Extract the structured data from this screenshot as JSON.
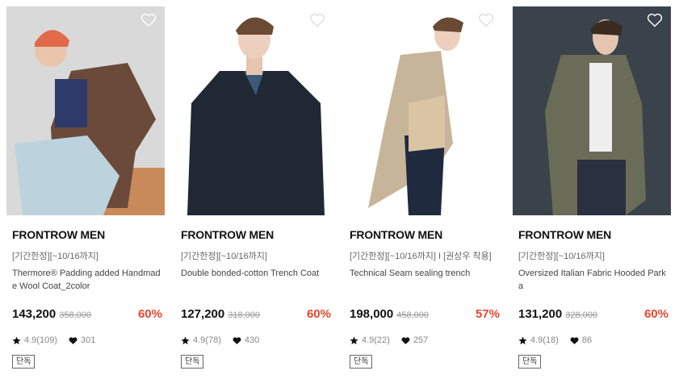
{
  "products": [
    {
      "brand": "FRONTROW MEN",
      "promo": "[기간한정][~10/16까지]",
      "name": "Thermore® Padding added Handmade Wool Coat_2color",
      "price": "143,200",
      "original_price": "358,000",
      "discount": "60%",
      "rating": "4.9(109)",
      "likes": "301",
      "tag": "단독",
      "colors": {
        "bg": "#d9d9d9",
        "coat": "#6b4a3a",
        "trouser": "#bcd3de",
        "accent": "#e06a4a"
      }
    },
    {
      "brand": "FRONTROW MEN",
      "promo": "[기간한정][~10/16까지]",
      "name": "Double bonded-cotton Trench Coat",
      "price": "127,200",
      "original_price": "318,000",
      "discount": "60%",
      "rating": "4.9(78)",
      "likes": "430",
      "tag": "단독",
      "colors": {
        "bg": "#ffffff",
        "coat": "#1f2833",
        "trouser": "#1f2833",
        "accent": "#3a5a7a"
      }
    },
    {
      "brand": "FRONTROW MEN",
      "promo": "[기간한정][~10/16까지] I [권상우 착용]",
      "name": "Technical Seam sealing trench",
      "price": "198,000",
      "original_price": "458,000",
      "discount": "57%",
      "rating": "4.9(22)",
      "likes": "257",
      "tag": "단독",
      "colors": {
        "bg": "#ffffff",
        "coat": "#c7b59a",
        "trouser": "#1f2a3f",
        "accent": "#d9c4a4"
      }
    },
    {
      "brand": "FRONTROW MEN",
      "promo": "[기간한정][~10/16까지]",
      "name": "Oversized Italian Fabric Hooded Parka",
      "price": "131,200",
      "original_price": "328,000",
      "discount": "60%",
      "rating": "4.9(18)",
      "likes": "86",
      "tag": "단독",
      "colors": {
        "bg": "#3a434b",
        "coat": "#6b6c58",
        "trouser": "#2a3040",
        "accent": "#eeeeee"
      }
    }
  ],
  "icons": {
    "wishlist": "heart-outline-icon",
    "rating": "star-icon",
    "likes": "heart-filled-icon"
  },
  "accent_color": "#e8472c"
}
